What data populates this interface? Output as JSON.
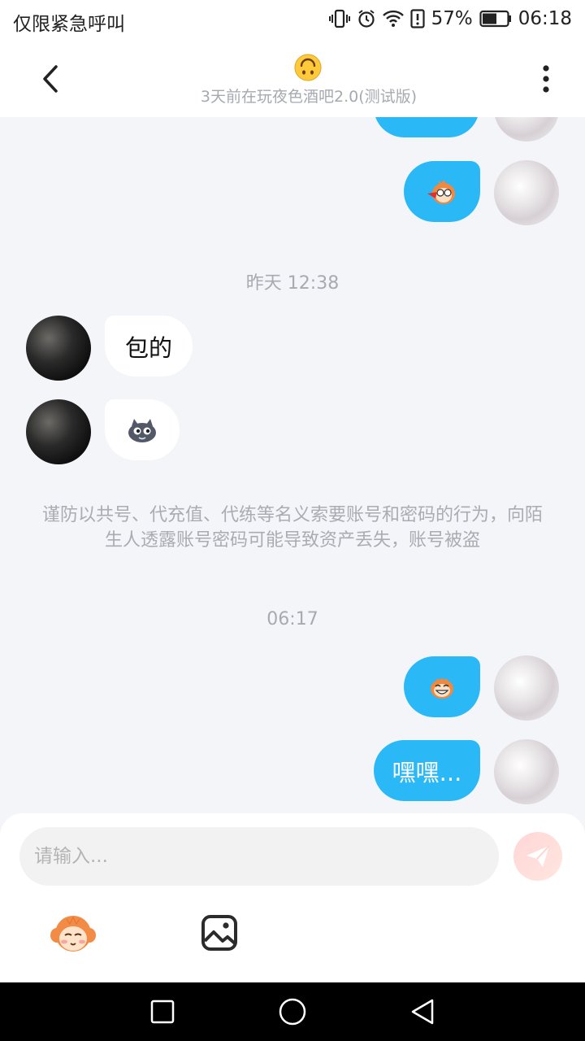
{
  "status_bar": {
    "carrier": "仅限紧急呼叫",
    "battery": "57%",
    "time": "06:18"
  },
  "header": {
    "title_icon": "upside-down-face-emoji",
    "subtitle": "3天前在玩夜色酒吧2.0(测试版)"
  },
  "messages": {
    "sent_partial_1": "",
    "sent_sticker_1": "sticker",
    "time_1": "昨天 12:38",
    "received_text_1": "包的",
    "received_sticker_1": "sticker",
    "notice": "谨防以共号、代充值、代练等名义索要账号和密码的行为，向陌生人透露账号密码可能导致资产丢失，账号被盗",
    "time_2": "06:17",
    "sent_sticker_2": "sticker",
    "sent_text_1": "嘿嘿..."
  },
  "input": {
    "placeholder": "请输入..."
  },
  "colors": {
    "accent": "#2bb8f6",
    "background": "#f4f5f9"
  }
}
